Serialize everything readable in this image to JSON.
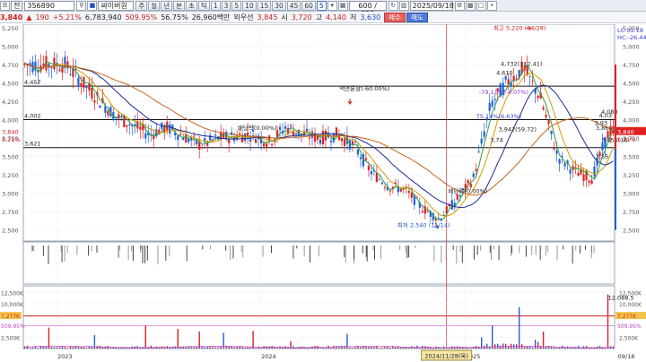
{
  "toolbar": {
    "menu_label": "전",
    "code": "356890",
    "stock_name": "싸이버원",
    "periods": [
      "주",
      "월",
      "년",
      "분",
      "초",
      "틱"
    ],
    "intervals": [
      "1",
      "3",
      "5",
      "10",
      "15",
      "30",
      "45",
      "60"
    ],
    "count_sel": "5",
    "count": "600 / 600",
    "date": "2025/09/18"
  },
  "info": {
    "price": "3,840",
    "change": "190",
    "change_pct": "+5.21%",
    "volume": "6,783,940",
    "vol_ratio": "509.95%",
    "turnover": "56.75%",
    "trade_value": "26,960백만",
    "pref_label": "외우선",
    "pref_value": "3,845",
    "open_label": "시",
    "open": "3,720",
    "high_label": "고",
    "high": "4,140",
    "low_label": "저",
    "low": "3,630",
    "buy_label": "매수",
    "sell_label": "매도"
  },
  "legend": {
    "lc": "LC:51.18",
    "hc": "HC:-26.44"
  },
  "chart_data": {
    "type": "line",
    "title": "",
    "price_axis": {
      "ylim": [
        2350,
        5300
      ],
      "ticks": [
        5250,
        5000,
        4750,
        4500,
        4250,
        4000,
        3750,
        3500,
        3250,
        3000,
        2750,
        2500
      ]
    },
    "x_axis": {
      "labels": [
        "2023",
        "2024",
        "2025",
        "09/18"
      ],
      "crosshair_label": "2024/11/28(목)"
    },
    "price_series": [
      {
        "date": "2023-01",
        "value": 4750
      },
      {
        "date": "2023-02",
        "value": 4500
      },
      {
        "date": "2023-04",
        "value": 4050
      },
      {
        "date": "2023-06",
        "value": 3800
      },
      {
        "date": "2023-07",
        "value": 3900
      },
      {
        "date": "2023-09",
        "value": 3650
      },
      {
        "date": "2023-10",
        "value": 3750
      },
      {
        "date": "2023-12",
        "value": 3800
      },
      {
        "date": "2024-01",
        "value": 3700
      },
      {
        "date": "2024-02",
        "value": 3900
      },
      {
        "date": "2024-03",
        "value": 3800
      },
      {
        "date": "2024-04",
        "value": 3750
      },
      {
        "date": "2024-05",
        "value": 3800
      },
      {
        "date": "2024-06",
        "value": 3650
      },
      {
        "date": "2024-07",
        "value": 3300
      },
      {
        "date": "2024-08",
        "value": 3100
      },
      {
        "date": "2024-09",
        "value": 3050
      },
      {
        "date": "2024-10",
        "value": 2800
      },
      {
        "date": "2024-11",
        "value": 2650
      },
      {
        "date": "2024-12",
        "value": 2900
      },
      {
        "date": "2025-01",
        "value": 3200
      },
      {
        "date": "2025-02",
        "value": 4200
      },
      {
        "date": "2025-03",
        "value": 4500
      },
      {
        "date": "2025-04",
        "value": 4700
      },
      {
        "date": "2025-05",
        "value": 4300
      },
      {
        "date": "2025-06",
        "value": 3500
      },
      {
        "date": "2025-07",
        "value": 3300
      },
      {
        "date": "2025-08",
        "value": 3200
      },
      {
        "date": "2025-09",
        "value": 3840
      }
    ],
    "horizontal_levels": [
      {
        "label": "4,457",
        "value": 4457
      },
      {
        "label": "4,002",
        "value": 4002
      },
      {
        "label": "3,621",
        "value": 3621
      }
    ],
    "annotations": [
      {
        "text": "최고 5,220 (04/28)",
        "value": 5220
      },
      {
        "text": "최저 2,540 (11/14)",
        "value": 2540
      },
      {
        "text": "액면분할(-60.00%)",
        "value": 4400
      },
      {
        "text": "4,732(112.41)",
        "value": 4732
      },
      {
        "text": "4,610",
        "value": 4610
      },
      {
        "text": "-79.11%(-4.07%)",
        "value": 4350
      },
      {
        "text": "75.14%(6.63%)",
        "value": 4020
      },
      {
        "text": "3,942(59.72)",
        "value": 3842
      },
      {
        "text": "3,74",
        "value": 3700
      },
      {
        "text": "4,080",
        "value": 4080
      },
      {
        "text": "4,03",
        "value": 4030
      },
      {
        "text": "3,93",
        "value": 3930
      },
      {
        "text": "3,860",
        "value": 3860
      },
      {
        "text": "3,656(16",
        "value": 3700
      },
      {
        "text": "3,55",
        "value": 3470
      },
      {
        "text": "배당락(0.00%)",
        "value": 3860
      },
      {
        "text": "배당락(0.00%)",
        "value": 3000
      }
    ],
    "current_price": {
      "label": "3,840",
      "value": 3840
    },
    "current_change": {
      "label": "5.21%"
    },
    "volume_axis": {
      "ylim": [
        0,
        14000
      ],
      "ticks": [
        "12,500K",
        "10,000K",
        "7,500K",
        "5,000K",
        "2,500K"
      ],
      "markers": [
        {
          "label": "7,277K",
          "value": 7277
        },
        {
          "label": "509.95%",
          "value": 5100
        }
      ],
      "peak": {
        "label": "12,088.5",
        "value": 12088
      }
    }
  }
}
